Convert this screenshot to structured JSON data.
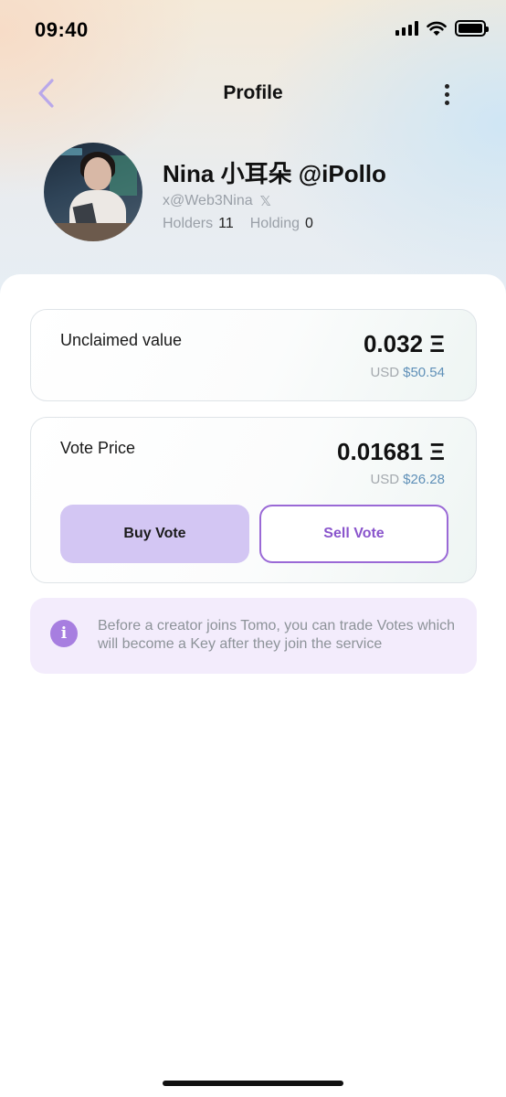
{
  "status_bar": {
    "time": "09:40"
  },
  "header": {
    "title": "Profile"
  },
  "profile": {
    "name": "Nina 小耳朵 @iPollo",
    "handle": "x@Web3Nina",
    "holders_label": "Holders",
    "holders_value": "11",
    "holding_label": "Holding",
    "holding_value": "0"
  },
  "unclaimed": {
    "label": "Unclaimed value",
    "amount": "0.032 Ξ",
    "usd_label": "USD",
    "usd_value": "$50.54"
  },
  "vote": {
    "label": "Vote Price",
    "amount": "0.01681 Ξ",
    "usd_label": "USD",
    "usd_value": "$26.28",
    "buy_label": "Buy Vote",
    "sell_label": "Sell Vote"
  },
  "info": {
    "icon": "i",
    "text": "Before a creator joins Tomo, you can trade Votes which will become a Key after they join the service"
  },
  "colors": {
    "accent": "#9a69d6",
    "buy_bg": "#d3c6f3",
    "info_bg": "#f3ecfc",
    "usd_value": "#5f90b8"
  },
  "icons": [
    "back-chevron-icon",
    "more-vertical-icon",
    "x-logo-icon",
    "info-icon",
    "signal-icon",
    "wifi-icon",
    "battery-icon"
  ]
}
